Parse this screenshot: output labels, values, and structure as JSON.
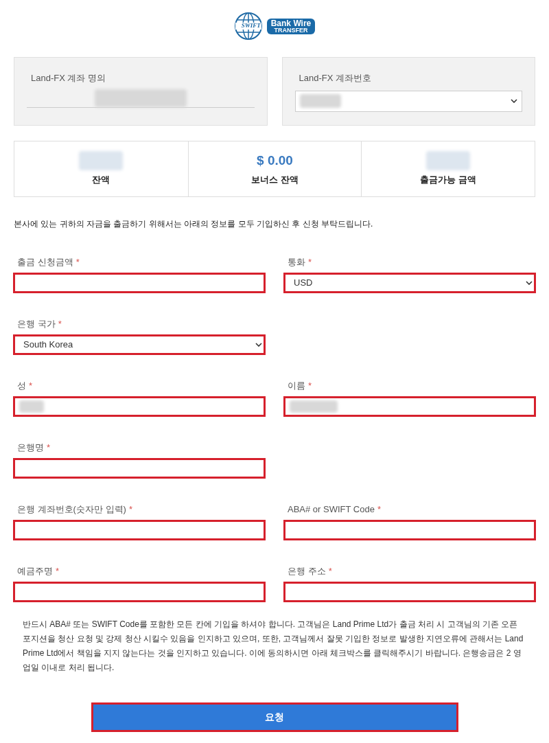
{
  "logo": {
    "globe_text": "SWIFT",
    "line1": "Bank Wire",
    "line2": "TRANSFER"
  },
  "account_name": {
    "label": "Land-FX 계좌 명의",
    "redacted": true
  },
  "account_number": {
    "label": "Land-FX 계좌번호",
    "redacted": true
  },
  "balances": [
    {
      "label": "잔액",
      "redacted": true
    },
    {
      "label": "보너스 잔액",
      "value": "$ 0.00"
    },
    {
      "label": "출금가능 금액",
      "redacted": true
    }
  ],
  "intro": "본사에 있는 귀하의 자금을 출금하기 위해서는 아래의 정보를 모두 기입하신 후 신청 부탁드립니다.",
  "form_rows": [
    [
      {
        "label": "출금 신청금액",
        "required": true,
        "kind": "input"
      },
      {
        "label": "통화",
        "required": true,
        "kind": "select",
        "value": "USD"
      }
    ],
    [
      {
        "label": "은행 국가",
        "required": true,
        "kind": "select",
        "value": "South Korea"
      }
    ],
    [
      {
        "label": "성",
        "required": true,
        "kind": "input",
        "redacted": true
      },
      {
        "label": "이름",
        "required": true,
        "kind": "input",
        "redacted": true
      }
    ],
    [
      {
        "label": "은행명",
        "required": true,
        "kind": "input"
      }
    ],
    [
      {
        "label": "은행 계좌번호(숫자만 입력)",
        "required": true,
        "kind": "input"
      },
      {
        "label": "ABA# or SWIFT Code",
        "required": true,
        "kind": "input"
      }
    ],
    [
      {
        "label": "예금주명",
        "required": true,
        "kind": "input"
      },
      {
        "label": "은행 주소",
        "required": true,
        "kind": "input"
      }
    ]
  ],
  "required_mark": "*",
  "notice": "반드시 ABA# 또는 SWIFT Code를 포함한 모든 칸에 기입을 하셔야 합니다. 고객님은 Land Prime Ltd가 출금 처리 시 고객님의 기존 오픈 포지션을 청산 요청 및 강제 청산 시킬수 있음을 인지하고 있으며, 또한, 고객님께서 잘못 기입한 정보로 발생한 지연오류에 관해서는 Land Prime Ltd에서 책임을 지지 않는다는 것을 인지하고 있습니다. 이에 동의하시면 아래 체크박스를 클릭해주시기 바랍니다. 은행송금은 2 영업일 이내로 처리 됩니다.",
  "submit_button": "요청"
}
